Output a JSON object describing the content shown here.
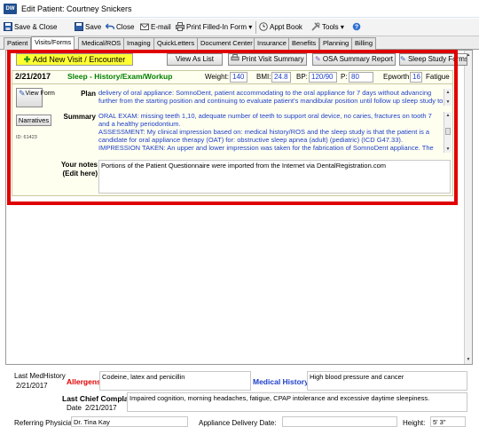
{
  "window": {
    "title": "Edit Patient: Courtney Snickers",
    "icon_text": "DW"
  },
  "toolbar": {
    "save_close": "Save & Close",
    "save": "Save",
    "close": "Close",
    "email": "E-mail",
    "print_form": "Print Filled-In Form",
    "appt_book": "Appt Book",
    "tools": "Tools",
    "dropdown_glyph": "▾"
  },
  "tabs": [
    "Patient",
    "Visits/Forms",
    "Medical/ROS",
    "Imaging",
    "QuickLetters",
    "Document Center",
    "Insurance",
    "Benefits",
    "Planning",
    "Billing"
  ],
  "actions": {
    "add_visit": "Add New Visit / Encounter",
    "view_as_list": "View As List",
    "print_visit_summary": "Print Visit Summary",
    "osa_summary_report": "OSA Summary Report",
    "sleep_study_forms": "Sleep Study Forms"
  },
  "visit": {
    "date": "2/21/2017",
    "type": "Sleep - History/Exam/Workup",
    "weight_label": "Weight:",
    "weight": "140",
    "bmi_label": "BMI:",
    "bmi": "24.8",
    "bp_label": "BP:",
    "bp": "120/90",
    "p_label": "P:",
    "p": "80",
    "epworth_label": "Epworth",
    "epworth": "16",
    "epworth_desc": "Fatigue",
    "view_form": "View Form",
    "narratives": "Narratives",
    "id": "ID: 61423",
    "plan_label": "Plan",
    "plan_text": "delivery of oral appliance: SomnoDent, patient accommodating to the oral appliance for 7 days without advancing further from the starting position and continuing to evaluate patient's mandibular position until follow up sleep study to",
    "summary_label": "Summary",
    "summary_text": "ORAL EXAM: missing teeth 1,10, adequate number of teeth to support oral device, no caries, fractures on tooth 7 and a healthy periodontium.\nASSESSMENT: My clinical impression based on: medical history/ROS and the sleep study is that the patient is a candidate for oral appliance therapy (OAT) for: obstructive sleep apnea (adult) (pediatric) (ICD G47.33).\nIMPRESSION TAKEN: An upper and lower impression was taken for the fabrication of SomnoDent appliance.  The",
    "notes_label": "Your notes (Edit here)",
    "notes_text": "Portions of the Patient Questionnaire were imported from the Internet via DentalRegistration.com"
  },
  "history": {
    "last_med_label": "Last MedHistory",
    "last_med_date": "2/21/2017",
    "allergens_label": "Allergens",
    "allergens": "Codeine, latex and penicillin",
    "medical_history_label": "Medical History",
    "medical_history": "High blood pressure and cancer",
    "chief_label": "Last Chief Complaints",
    "date_label": "Date",
    "chief_date": "2/21/2017",
    "chief_text": "Impaired cognition, morning headaches, fatigue, CPAP intolerance and excessive daytime sleepiness.",
    "referring_label": "Referring Physician",
    "referring": "Dr. Tina Kay",
    "appliance_label": "Appliance Delivery Date:",
    "height_label": "Height:",
    "height": "5' 3\""
  },
  "colors": {
    "highlight": "#e00000",
    "add_visit_bg": "#ffff33",
    "visit_type": "#008000",
    "allergens": "#e00000",
    "link_blue": "#1d3fc9"
  }
}
